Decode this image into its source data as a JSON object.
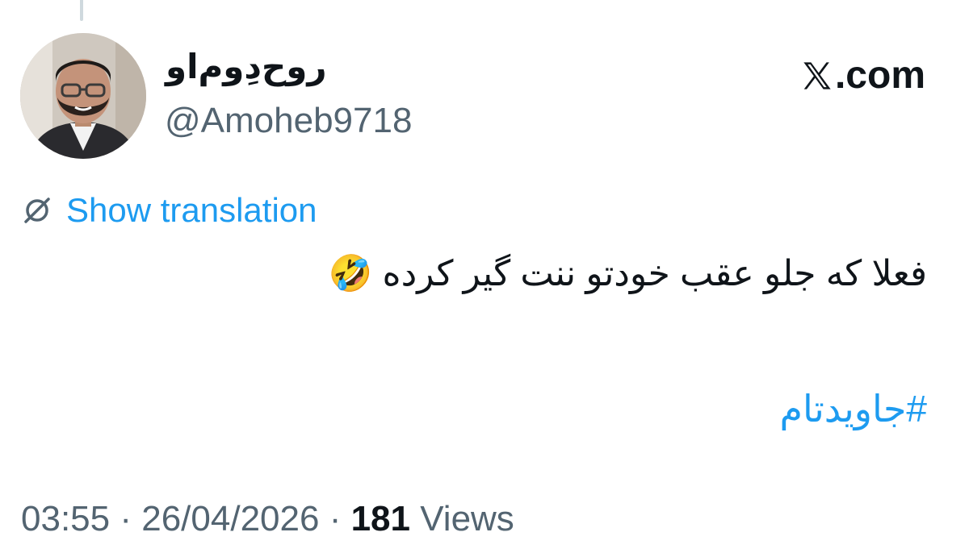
{
  "author": {
    "display_name": "روح‌دِوم‌او",
    "handle": "@Amoheb9718",
    "avatar_icon": "profile-photo"
  },
  "brand": {
    "label": ".com",
    "icon": "x-logo-icon"
  },
  "translation": {
    "label": "Show translation",
    "icon": "globe-slash-icon"
  },
  "tweet": {
    "text": "فعلا که جلو عقب خودتو ننت گیر کرده 🤣",
    "hashtag": "#جاویدتام"
  },
  "meta": {
    "time": "03:55",
    "separator": "·",
    "date": "26/04/2026",
    "views_count": "181",
    "views_label": "Views"
  },
  "colors": {
    "accent": "#1d9bf0",
    "text": "#0f1419",
    "muted": "#536471",
    "thread_line": "#cfd9de"
  }
}
